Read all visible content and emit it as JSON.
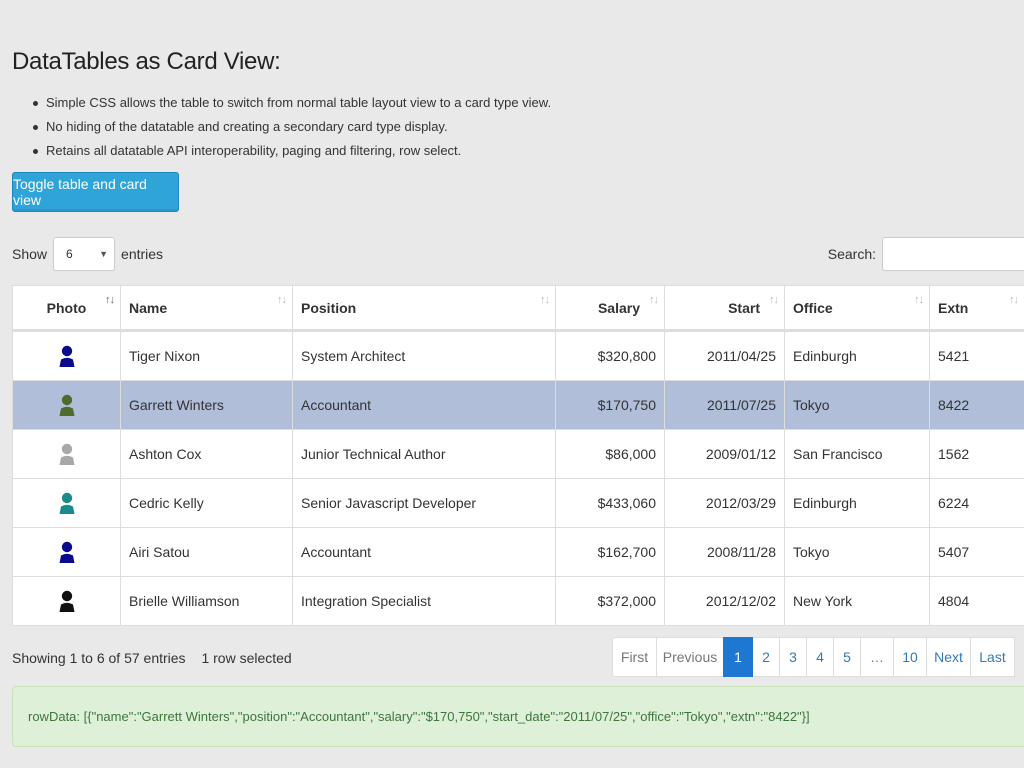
{
  "page": {
    "title": "DataTables as Card View:"
  },
  "bullets": [
    "Simple CSS allows the table to switch from normal table layout view to a card type view.",
    "No hiding of the datatable and creating a secondary card type display.",
    "Retains all datatable API interoperability, paging and filtering, row select."
  ],
  "toggle_button": "Toggle table and card view",
  "length": {
    "show": "Show",
    "value": "6",
    "entries": "entries"
  },
  "search": {
    "label": "Search:",
    "value": ""
  },
  "table": {
    "headers": [
      "Photo",
      "Name",
      "Position",
      "Salary",
      "Start",
      "Office",
      "Extn"
    ],
    "rows": [
      {
        "name": "Tiger Nixon",
        "position": "System Architect",
        "salary": "$320,800",
        "start": "2011/04/25",
        "office": "Edinburgh",
        "extn": "5421",
        "photo_color": "#0a0a8c",
        "selected": false
      },
      {
        "name": "Garrett Winters",
        "position": "Accountant",
        "salary": "$170,750",
        "start": "2011/07/25",
        "office": "Tokyo",
        "extn": "8422",
        "photo_color": "#4f6b2e",
        "selected": true
      },
      {
        "name": "Ashton Cox",
        "position": "Junior Technical Author",
        "salary": "$86,000",
        "start": "2009/01/12",
        "office": "San Francisco",
        "extn": "1562",
        "photo_color": "#a8a8a8",
        "selected": false
      },
      {
        "name": "Cedric Kelly",
        "position": "Senior Javascript Developer",
        "salary": "$433,060",
        "start": "2012/03/29",
        "office": "Edinburgh",
        "extn": "6224",
        "photo_color": "#1a8a8a",
        "selected": false
      },
      {
        "name": "Airi Satou",
        "position": "Accountant",
        "salary": "$162,700",
        "start": "2008/11/28",
        "office": "Tokyo",
        "extn": "5407",
        "photo_color": "#0a0a8c",
        "selected": false
      },
      {
        "name": "Brielle Williamson",
        "position": "Integration Specialist",
        "salary": "$372,000",
        "start": "2012/12/02",
        "office": "New York",
        "extn": "4804",
        "photo_color": "#111111",
        "selected": false
      }
    ]
  },
  "info": {
    "text": "Showing 1 to 6 of 57 entries",
    "selected": "1 row selected"
  },
  "pagination": [
    "First",
    "Previous",
    "1",
    "2",
    "3",
    "4",
    "5",
    "…",
    "10",
    "Next",
    "Last"
  ],
  "pagination_active": "1",
  "row_data": "rowData: [{\"name\":\"Garrett Winters\",\"position\":\"Accountant\",\"salary\":\"$170,750\",\"start_date\":\"2011/07/25\",\"office\":\"Tokyo\",\"extn\":\"8422\"}]"
}
